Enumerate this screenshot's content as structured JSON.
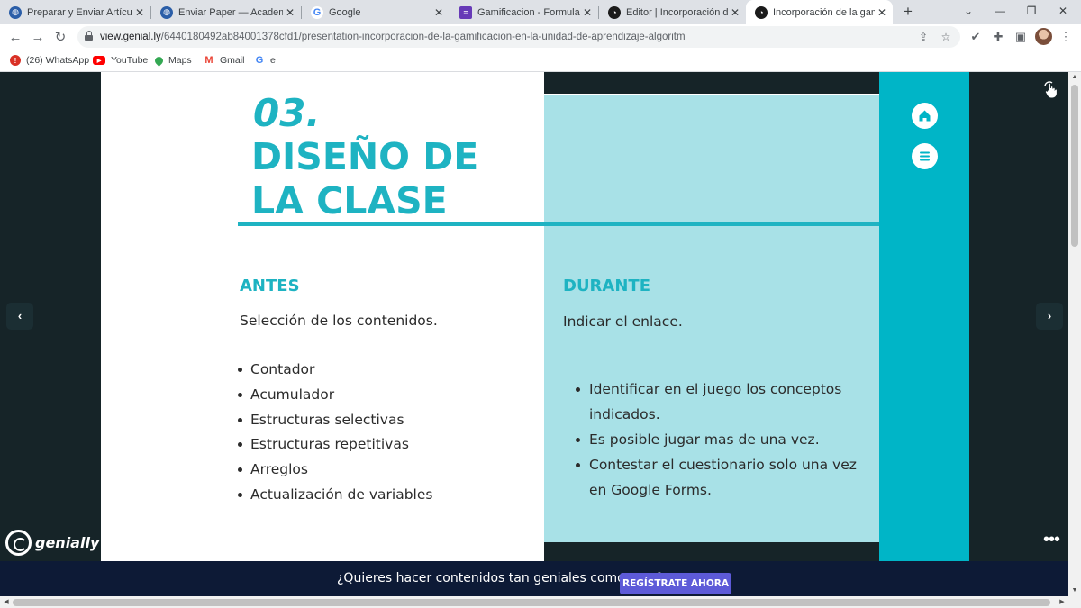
{
  "browser": {
    "tabs": [
      {
        "title": "Preparar y Enviar Artículo y",
        "favicon": "globe-icon",
        "active": false
      },
      {
        "title": "Enviar Paper — Academia",
        "favicon": "globe-icon",
        "active": false
      },
      {
        "title": "Google",
        "favicon": "google-icon",
        "active": false
      },
      {
        "title": "Gamificacion - Formularios",
        "favicon": "forms-icon",
        "active": false
      },
      {
        "title": "Editor | Incorporación de la",
        "favicon": "genially-icon",
        "active": false
      },
      {
        "title": "Incorporación de la gamific",
        "favicon": "genially-icon",
        "active": true
      }
    ],
    "url": {
      "host": "view.genial.ly",
      "path": "/6440180492ab84001378cfd1/presentation-incorporacion-de-la-gamificacion-en-la-unidad-de-aprendizaje-algoritm"
    },
    "bookmarks": [
      {
        "label": "(26) WhatsApp",
        "icon": "whatsapp-icon",
        "color": "#d93025"
      },
      {
        "label": "YouTube",
        "icon": "youtube-icon",
        "color": "#ff0000"
      },
      {
        "label": "Maps",
        "icon": "maps-icon",
        "color": "#34a853"
      },
      {
        "label": "Gmail",
        "icon": "gmail-icon",
        "color": "#ea4335"
      },
      {
        "label": "e",
        "icon": "google-icon",
        "color": "#4285f4"
      }
    ]
  },
  "slide": {
    "section_number": "03.",
    "section_title": "DISEÑO DE LA CLASE",
    "antes": {
      "heading": "ANTES",
      "intro": "Selección de los contenidos.",
      "items": [
        "Contador",
        "Acumulador",
        "Estructuras selectivas",
        "Estructuras repetitivas",
        "Arreglos",
        "Actualización de variables"
      ]
    },
    "durante": {
      "heading": "DURANTE",
      "intro": "Indicar el enlace.",
      "items": [
        "Identificar en el juego los conceptos indicados.",
        "Es posible jugar mas de una vez.",
        "Contestar el cuestionario solo una vez en Google Forms."
      ]
    },
    "accent_color": "#1eb3c2",
    "panel_color": "#a8e1e7",
    "sidebar_color": "#00b5c7"
  },
  "viewer": {
    "brand": "genially",
    "cta_text": "¿Quieres hacer contenidos tan geniales como este?",
    "cta_button": "REGÍSTRATE AHORA"
  }
}
